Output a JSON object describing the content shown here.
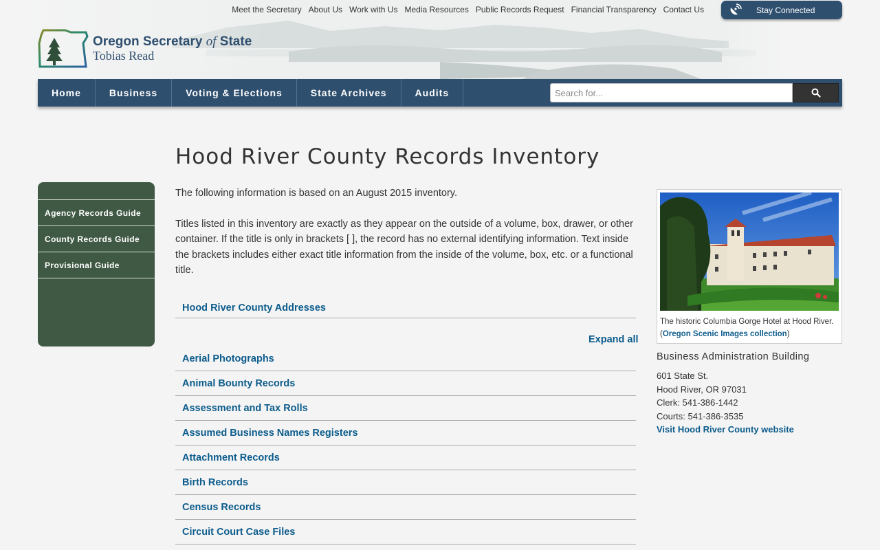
{
  "utility_nav": [
    "Meet the Secretary",
    "About Us",
    "Work with Us",
    "Media Resources",
    "Public Records Request",
    "Financial Transparency",
    "Contact Us"
  ],
  "stay_connected": "Stay Connected",
  "logo": {
    "line1_a": "Oregon Secretary ",
    "line1_b": "of",
    "line1_c": " State",
    "line2": "Tobias Read"
  },
  "main_nav": [
    "Home",
    "Business",
    "Voting & Elections",
    "State Archives",
    "Audits"
  ],
  "search": {
    "placeholder": "Search for..."
  },
  "page_title": "Hood River County Records Inventory",
  "sidebar": [
    "Agency Records Guide",
    "County Records Guide",
    "Provisional Guide"
  ],
  "intro": [
    "The following information is based on an August 2015 inventory.",
    "Titles listed in this inventory are exactly as they appear on the outside of a volume, box, drawer, or other container. If the title is only in brackets [ ], the record has no external identifying information. Text inside the brackets includes either exact title information from the inside of the volume, box, etc. or a functional title."
  ],
  "addresses_link": "Hood River County Addresses",
  "expand_all": "Expand all",
  "records": [
    "Aerial Photographs",
    "Animal Bounty Records",
    "Assessment and Tax Rolls",
    "Assumed Business Names Registers",
    "Attachment Records",
    "Birth Records",
    "Census Records",
    "Circuit Court Case Files"
  ],
  "photo": {
    "caption": "The historic Columbia Gorge Hotel at Hood River.",
    "open": "(",
    "link": "Oregon Scenic Images collection",
    "close": ")"
  },
  "building": {
    "title": "Business Administration Building",
    "street": "601 State St.",
    "city": "Hood River, OR 97031",
    "clerk": "Clerk: 541-386-1442",
    "courts": "Courts: 541-386-3535",
    "website": "Visit Hood River County website"
  },
  "colors": {
    "nav": "#2f4f6f",
    "sidebar": "#3f5944",
    "link": "#0c5c8c"
  }
}
